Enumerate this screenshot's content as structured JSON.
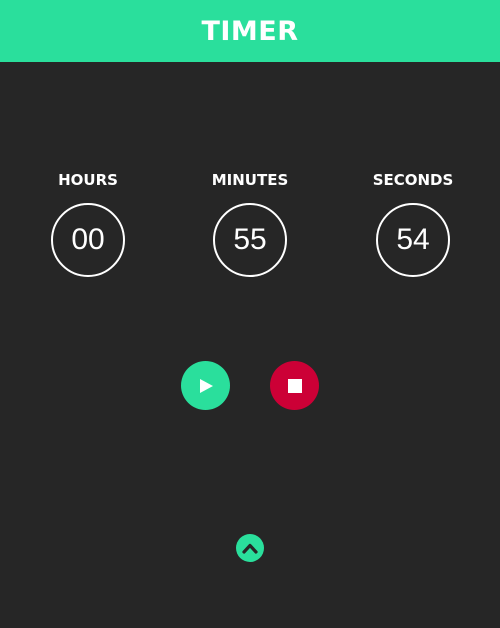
{
  "header": {
    "title": "TIMER"
  },
  "timer": {
    "units": [
      {
        "label": "HOURS",
        "value": "00"
      },
      {
        "label": "MINUTES",
        "value": "55"
      },
      {
        "label": "SECONDS",
        "value": "54"
      }
    ]
  },
  "controls": {
    "play": {
      "icon": "play-icon"
    },
    "stop": {
      "icon": "stop-icon"
    },
    "collapse": {
      "icon": "chevron-up-icon"
    }
  },
  "colors": {
    "accent": "#2adf9c",
    "stop": "#cc0036",
    "background": "#262626",
    "text": "#ffffff"
  }
}
